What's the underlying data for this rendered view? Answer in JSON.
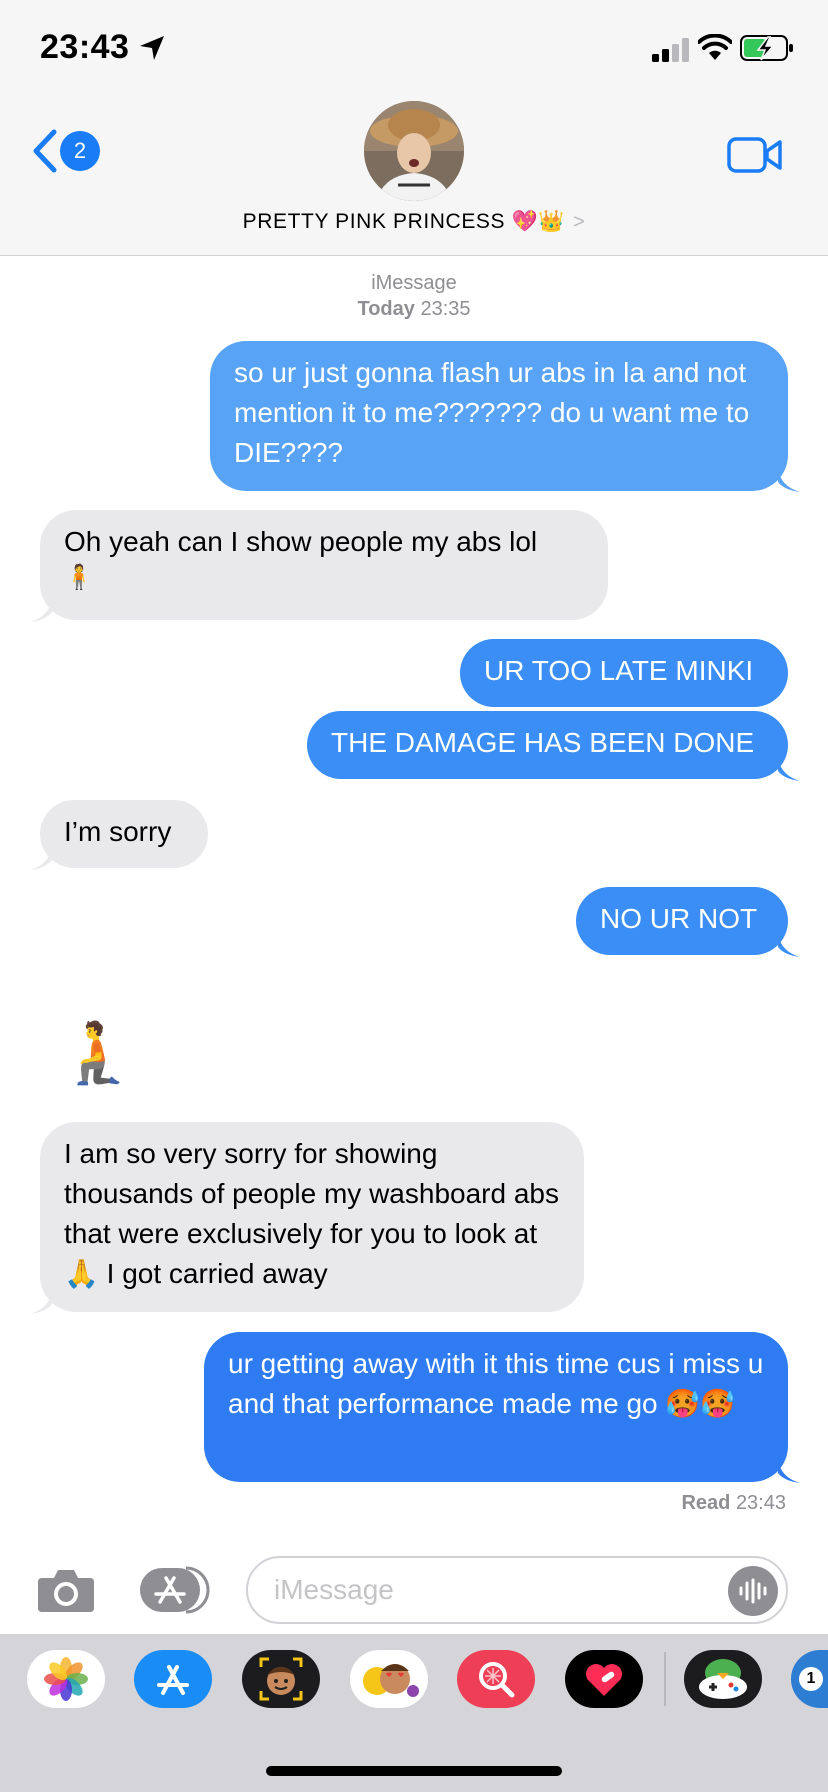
{
  "status_bar": {
    "time": "23:43"
  },
  "header": {
    "back_badge": "2",
    "contact_name": "PRETTY PINK PRINCESS 💖👑",
    "contact_chevron": ">"
  },
  "thread": {
    "service": "iMessage",
    "date_day": "Today",
    "date_time": "23:35",
    "messages": [
      {
        "from": "me",
        "text": "so ur just gonna flash ur abs in la and not mention it to me??????? do u want me to DIE????"
      },
      {
        "from": "them",
        "text": "Oh yeah can I show people my abs lol",
        "emoji": "🧍"
      },
      {
        "from": "me",
        "text": "UR TOO LATE MINKI"
      },
      {
        "from": "me",
        "text": "THE DAMAGE HAS BEEN DONE"
      },
      {
        "from": "them",
        "text": "I’m sorry"
      },
      {
        "from": "me",
        "text": "NO UR NOT"
      },
      {
        "from": "them",
        "text": "🧎"
      },
      {
        "from": "them",
        "text": "I am so very sorry for showing thousands of people my washboard abs that were exclusively for you to look at 🙏 I got carried away"
      },
      {
        "from": "me",
        "text": "ur getting away with it this time cus i miss u and that performance made me go 🥵🥵"
      }
    ],
    "read_label": "Read",
    "read_time": "23:43"
  },
  "input": {
    "placeholder": "iMessage"
  },
  "app_drawer": {
    "apps": [
      "photos-app",
      "app-store-app",
      "memoji-app",
      "animoji-stickers-app",
      "image-search-app",
      "heart-app",
      "game-app",
      "partial-app"
    ],
    "partial_badge": "1"
  },
  "colors": {
    "accent": "#1a7df5",
    "out_bubble": "#3a8ef5",
    "in_bubble": "#e9e9eb"
  }
}
